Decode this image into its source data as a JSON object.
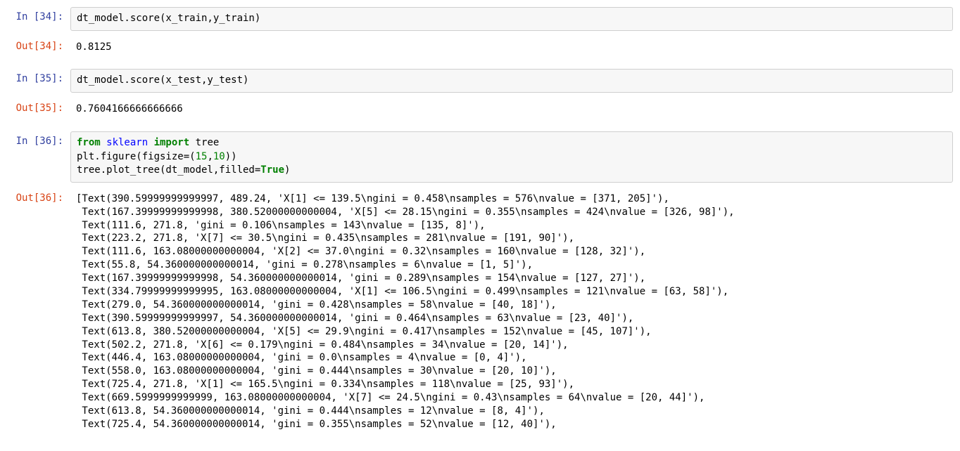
{
  "cells": [
    {
      "in_prompt": "In [34]:",
      "out_prompt": "Out[34]:",
      "code_plain": "dt_model.score(x_train,y_train)",
      "output": "0.8125"
    },
    {
      "in_prompt": "In [35]:",
      "out_prompt": "Out[35]:",
      "code_plain": "dt_model.score(x_test,y_test)",
      "output": "0.7604166666666666"
    },
    {
      "in_prompt": "In [36]:",
      "out_prompt": "Out[36]:",
      "code_line1_from": "from",
      "code_line1_sklearn": " sklearn ",
      "code_line1_import": "import",
      "code_line1_tree": " tree",
      "code_line2_pre": "plt.figure(figsize=(",
      "code_line2_n1": "15",
      "code_line2_comma": ",",
      "code_line2_n2": "10",
      "code_line2_post": "))",
      "code_line3_pre": "tree.plot_tree(dt_model,filled=",
      "code_line3_true": "True",
      "code_line3_post": ")",
      "output_lines": [
        "[Text(390.59999999999997, 489.24, 'X[1] <= 139.5\\ngini = 0.458\\nsamples = 576\\nvalue = [371, 205]'),",
        " Text(167.39999999999998, 380.52000000000004, 'X[5] <= 28.15\\ngini = 0.355\\nsamples = 424\\nvalue = [326, 98]'),",
        " Text(111.6, 271.8, 'gini = 0.106\\nsamples = 143\\nvalue = [135, 8]'),",
        " Text(223.2, 271.8, 'X[7] <= 30.5\\ngini = 0.435\\nsamples = 281\\nvalue = [191, 90]'),",
        " Text(111.6, 163.08000000000004, 'X[2] <= 37.0\\ngini = 0.32\\nsamples = 160\\nvalue = [128, 32]'),",
        " Text(55.8, 54.360000000000014, 'gini = 0.278\\nsamples = 6\\nvalue = [1, 5]'),",
        " Text(167.39999999999998, 54.360000000000014, 'gini = 0.289\\nsamples = 154\\nvalue = [127, 27]'),",
        " Text(334.79999999999995, 163.08000000000004, 'X[1] <= 106.5\\ngini = 0.499\\nsamples = 121\\nvalue = [63, 58]'),",
        " Text(279.0, 54.360000000000014, 'gini = 0.428\\nsamples = 58\\nvalue = [40, 18]'),",
        " Text(390.59999999999997, 54.360000000000014, 'gini = 0.464\\nsamples = 63\\nvalue = [23, 40]'),",
        " Text(613.8, 380.52000000000004, 'X[5] <= 29.9\\ngini = 0.417\\nsamples = 152\\nvalue = [45, 107]'),",
        " Text(502.2, 271.8, 'X[6] <= 0.179\\ngini = 0.484\\nsamples = 34\\nvalue = [20, 14]'),",
        " Text(446.4, 163.08000000000004, 'gini = 0.0\\nsamples = 4\\nvalue = [0, 4]'),",
        " Text(558.0, 163.08000000000004, 'gini = 0.444\\nsamples = 30\\nvalue = [20, 10]'),",
        " Text(725.4, 271.8, 'X[1] <= 165.5\\ngini = 0.334\\nsamples = 118\\nvalue = [25, 93]'),",
        " Text(669.5999999999999, 163.08000000000004, 'X[7] <= 24.5\\ngini = 0.43\\nsamples = 64\\nvalue = [20, 44]'),",
        " Text(613.8, 54.360000000000014, 'gini = 0.444\\nsamples = 12\\nvalue = [8, 4]'),",
        " Text(725.4, 54.360000000000014, 'gini = 0.355\\nsamples = 52\\nvalue = [12, 40]'),"
      ]
    }
  ]
}
